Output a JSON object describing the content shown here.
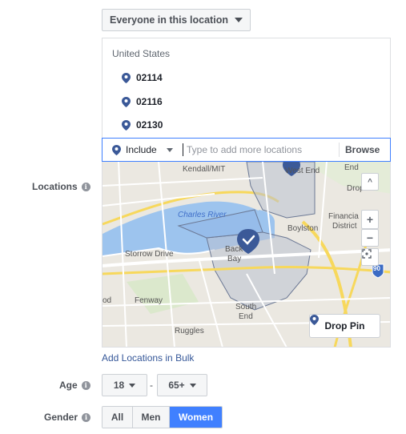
{
  "audience_dropdown": {
    "label": "Everyone in this location"
  },
  "locations": {
    "country": "United States",
    "items": [
      {
        "label": "02114"
      },
      {
        "label": "02116"
      },
      {
        "label": "02130"
      }
    ],
    "include_label": "Include",
    "input_placeholder": "Type to add more locations",
    "browse_label": "Browse"
  },
  "map": {
    "labels": {
      "kendall": "Kendall/MIT",
      "west_end": "West End",
      "end": "End",
      "drop": "Drop",
      "charles_river": "Charles River",
      "financial": "Financia",
      "district": "District",
      "boylston": "Boylston",
      "back": "Back",
      "bay": "Bay",
      "storrow": "Storrow Drive",
      "fenway": "Fenway",
      "south": "South",
      "end2": "End",
      "ruggles": "Ruggles",
      "od": "od",
      "highway": "90"
    },
    "controls": {
      "up": "^",
      "zoom_in": "+",
      "zoom_out": "−"
    },
    "drop_pin_label": "Drop Pin"
  },
  "add_bulk_label": "Add Locations in Bulk",
  "locations_label": "Locations",
  "age": {
    "label": "Age",
    "min": "18",
    "max": "65+",
    "dash": "-"
  },
  "gender": {
    "label": "Gender",
    "options": [
      {
        "label": "All"
      },
      {
        "label": "Men"
      },
      {
        "label": "Women"
      }
    ]
  },
  "info_glyph": "i",
  "colors": {
    "accent": "#4080ff",
    "pin": "#3b5998",
    "link": "#365899"
  }
}
